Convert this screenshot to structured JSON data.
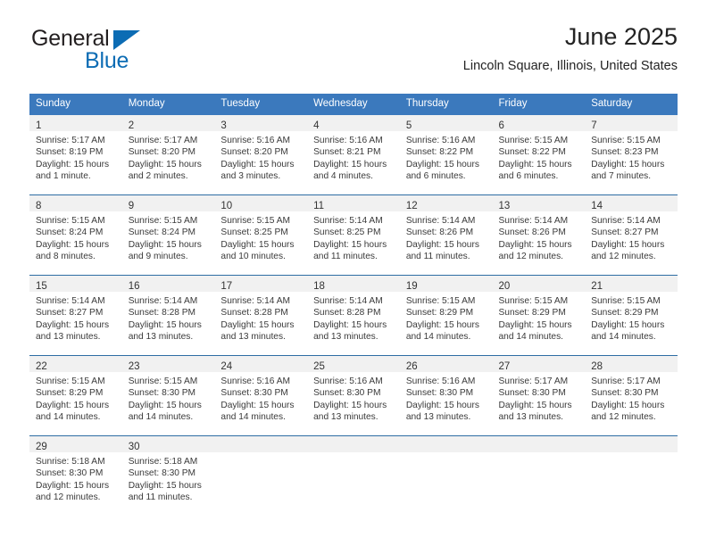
{
  "brand": {
    "name_part1": "General",
    "name_part2": "Blue",
    "logo_icon": "triangle-icon",
    "accent_color": "#0c6cb4"
  },
  "header": {
    "title": "June 2025",
    "location": "Lincoln Square, Illinois, United States"
  },
  "theme": {
    "header_bg": "#3b79bd",
    "row_divider": "#2e6da4",
    "daynum_bg": "#f1f1f1",
    "text": "#3a3a3a"
  },
  "weekdays": [
    "Sunday",
    "Monday",
    "Tuesday",
    "Wednesday",
    "Thursday",
    "Friday",
    "Saturday"
  ],
  "weeks": [
    {
      "days": [
        {
          "num": "1",
          "sunrise": "Sunrise: 5:17 AM",
          "sunset": "Sunset: 8:19 PM",
          "daylight": "Daylight: 15 hours and 1 minute."
        },
        {
          "num": "2",
          "sunrise": "Sunrise: 5:17 AM",
          "sunset": "Sunset: 8:20 PM",
          "daylight": "Daylight: 15 hours and 2 minutes."
        },
        {
          "num": "3",
          "sunrise": "Sunrise: 5:16 AM",
          "sunset": "Sunset: 8:20 PM",
          "daylight": "Daylight: 15 hours and 3 minutes."
        },
        {
          "num": "4",
          "sunrise": "Sunrise: 5:16 AM",
          "sunset": "Sunset: 8:21 PM",
          "daylight": "Daylight: 15 hours and 4 minutes."
        },
        {
          "num": "5",
          "sunrise": "Sunrise: 5:16 AM",
          "sunset": "Sunset: 8:22 PM",
          "daylight": "Daylight: 15 hours and 6 minutes."
        },
        {
          "num": "6",
          "sunrise": "Sunrise: 5:15 AM",
          "sunset": "Sunset: 8:22 PM",
          "daylight": "Daylight: 15 hours and 6 minutes."
        },
        {
          "num": "7",
          "sunrise": "Sunrise: 5:15 AM",
          "sunset": "Sunset: 8:23 PM",
          "daylight": "Daylight: 15 hours and 7 minutes."
        }
      ]
    },
    {
      "days": [
        {
          "num": "8",
          "sunrise": "Sunrise: 5:15 AM",
          "sunset": "Sunset: 8:24 PM",
          "daylight": "Daylight: 15 hours and 8 minutes."
        },
        {
          "num": "9",
          "sunrise": "Sunrise: 5:15 AM",
          "sunset": "Sunset: 8:24 PM",
          "daylight": "Daylight: 15 hours and 9 minutes."
        },
        {
          "num": "10",
          "sunrise": "Sunrise: 5:15 AM",
          "sunset": "Sunset: 8:25 PM",
          "daylight": "Daylight: 15 hours and 10 minutes."
        },
        {
          "num": "11",
          "sunrise": "Sunrise: 5:14 AM",
          "sunset": "Sunset: 8:25 PM",
          "daylight": "Daylight: 15 hours and 11 minutes."
        },
        {
          "num": "12",
          "sunrise": "Sunrise: 5:14 AM",
          "sunset": "Sunset: 8:26 PM",
          "daylight": "Daylight: 15 hours and 11 minutes."
        },
        {
          "num": "13",
          "sunrise": "Sunrise: 5:14 AM",
          "sunset": "Sunset: 8:26 PM",
          "daylight": "Daylight: 15 hours and 12 minutes."
        },
        {
          "num": "14",
          "sunrise": "Sunrise: 5:14 AM",
          "sunset": "Sunset: 8:27 PM",
          "daylight": "Daylight: 15 hours and 12 minutes."
        }
      ]
    },
    {
      "days": [
        {
          "num": "15",
          "sunrise": "Sunrise: 5:14 AM",
          "sunset": "Sunset: 8:27 PM",
          "daylight": "Daylight: 15 hours and 13 minutes."
        },
        {
          "num": "16",
          "sunrise": "Sunrise: 5:14 AM",
          "sunset": "Sunset: 8:28 PM",
          "daylight": "Daylight: 15 hours and 13 minutes."
        },
        {
          "num": "17",
          "sunrise": "Sunrise: 5:14 AM",
          "sunset": "Sunset: 8:28 PM",
          "daylight": "Daylight: 15 hours and 13 minutes."
        },
        {
          "num": "18",
          "sunrise": "Sunrise: 5:14 AM",
          "sunset": "Sunset: 8:28 PM",
          "daylight": "Daylight: 15 hours and 13 minutes."
        },
        {
          "num": "19",
          "sunrise": "Sunrise: 5:15 AM",
          "sunset": "Sunset: 8:29 PM",
          "daylight": "Daylight: 15 hours and 14 minutes."
        },
        {
          "num": "20",
          "sunrise": "Sunrise: 5:15 AM",
          "sunset": "Sunset: 8:29 PM",
          "daylight": "Daylight: 15 hours and 14 minutes."
        },
        {
          "num": "21",
          "sunrise": "Sunrise: 5:15 AM",
          "sunset": "Sunset: 8:29 PM",
          "daylight": "Daylight: 15 hours and 14 minutes."
        }
      ]
    },
    {
      "days": [
        {
          "num": "22",
          "sunrise": "Sunrise: 5:15 AM",
          "sunset": "Sunset: 8:29 PM",
          "daylight": "Daylight: 15 hours and 14 minutes."
        },
        {
          "num": "23",
          "sunrise": "Sunrise: 5:15 AM",
          "sunset": "Sunset: 8:30 PM",
          "daylight": "Daylight: 15 hours and 14 minutes."
        },
        {
          "num": "24",
          "sunrise": "Sunrise: 5:16 AM",
          "sunset": "Sunset: 8:30 PM",
          "daylight": "Daylight: 15 hours and 14 minutes."
        },
        {
          "num": "25",
          "sunrise": "Sunrise: 5:16 AM",
          "sunset": "Sunset: 8:30 PM",
          "daylight": "Daylight: 15 hours and 13 minutes."
        },
        {
          "num": "26",
          "sunrise": "Sunrise: 5:16 AM",
          "sunset": "Sunset: 8:30 PM",
          "daylight": "Daylight: 15 hours and 13 minutes."
        },
        {
          "num": "27",
          "sunrise": "Sunrise: 5:17 AM",
          "sunset": "Sunset: 8:30 PM",
          "daylight": "Daylight: 15 hours and 13 minutes."
        },
        {
          "num": "28",
          "sunrise": "Sunrise: 5:17 AM",
          "sunset": "Sunset: 8:30 PM",
          "daylight": "Daylight: 15 hours and 12 minutes."
        }
      ]
    },
    {
      "days": [
        {
          "num": "29",
          "sunrise": "Sunrise: 5:18 AM",
          "sunset": "Sunset: 8:30 PM",
          "daylight": "Daylight: 15 hours and 12 minutes."
        },
        {
          "num": "30",
          "sunrise": "Sunrise: 5:18 AM",
          "sunset": "Sunset: 8:30 PM",
          "daylight": "Daylight: 15 hours and 11 minutes."
        },
        {
          "num": "",
          "sunrise": "",
          "sunset": "",
          "daylight": ""
        },
        {
          "num": "",
          "sunrise": "",
          "sunset": "",
          "daylight": ""
        },
        {
          "num": "",
          "sunrise": "",
          "sunset": "",
          "daylight": ""
        },
        {
          "num": "",
          "sunrise": "",
          "sunset": "",
          "daylight": ""
        },
        {
          "num": "",
          "sunrise": "",
          "sunset": "",
          "daylight": ""
        }
      ]
    }
  ]
}
